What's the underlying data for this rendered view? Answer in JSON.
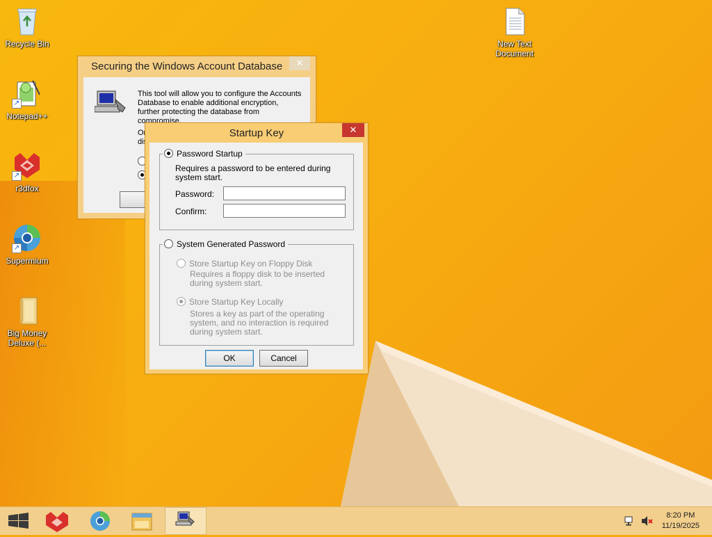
{
  "desktop": {
    "icons": [
      {
        "label": "Recycle Bin",
        "icon": "recycle-bin-icon"
      },
      {
        "label": "Notepad++",
        "icon": "notepad-plus-plus-icon"
      },
      {
        "label": "r3dfox",
        "icon": "r3dfox-icon"
      },
      {
        "label": "Supermium",
        "icon": "supermium-icon"
      },
      {
        "label": "Big Money Deluxe (...",
        "icon": "folder-icon"
      },
      {
        "label": "New Text Document",
        "icon": "text-document-icon"
      }
    ]
  },
  "bg_window": {
    "title": "Securing the Windows Account Database",
    "close_glyph": "✕",
    "description": "This tool will allow you to configure the Accounts Database to enable additional encryption, further protecting the database from compromise.",
    "partial_line1": "Or",
    "partial_line2": "dis",
    "partial_button": "OI"
  },
  "dialog": {
    "title": "Startup Key",
    "close_glyph": "✕",
    "password_startup": {
      "label": "Password Startup",
      "selected": true,
      "description": "Requires a password to be entered during system start.",
      "password_label": "Password:",
      "password_value": "",
      "confirm_label": "Confirm:",
      "confirm_value": ""
    },
    "system_generated": {
      "label": "System Generated Password",
      "selected": false,
      "floppy_label": "Store Startup Key on Floppy Disk",
      "floppy_desc": "Requires a floppy disk to be inserted during system start.",
      "local_label": "Store Startup Key Locally",
      "local_desc": "Stores a key as part of the operating system, and no interaction is required during system start."
    },
    "ok_label": "OK",
    "cancel_label": "Cancel"
  },
  "taskbar": {
    "time": "8:20 PM",
    "date": "11/19/2025"
  },
  "colors": {
    "wallpaper": "#f7aa10",
    "taskbar": "#f2cf8c",
    "close_red": "#c7372f"
  }
}
